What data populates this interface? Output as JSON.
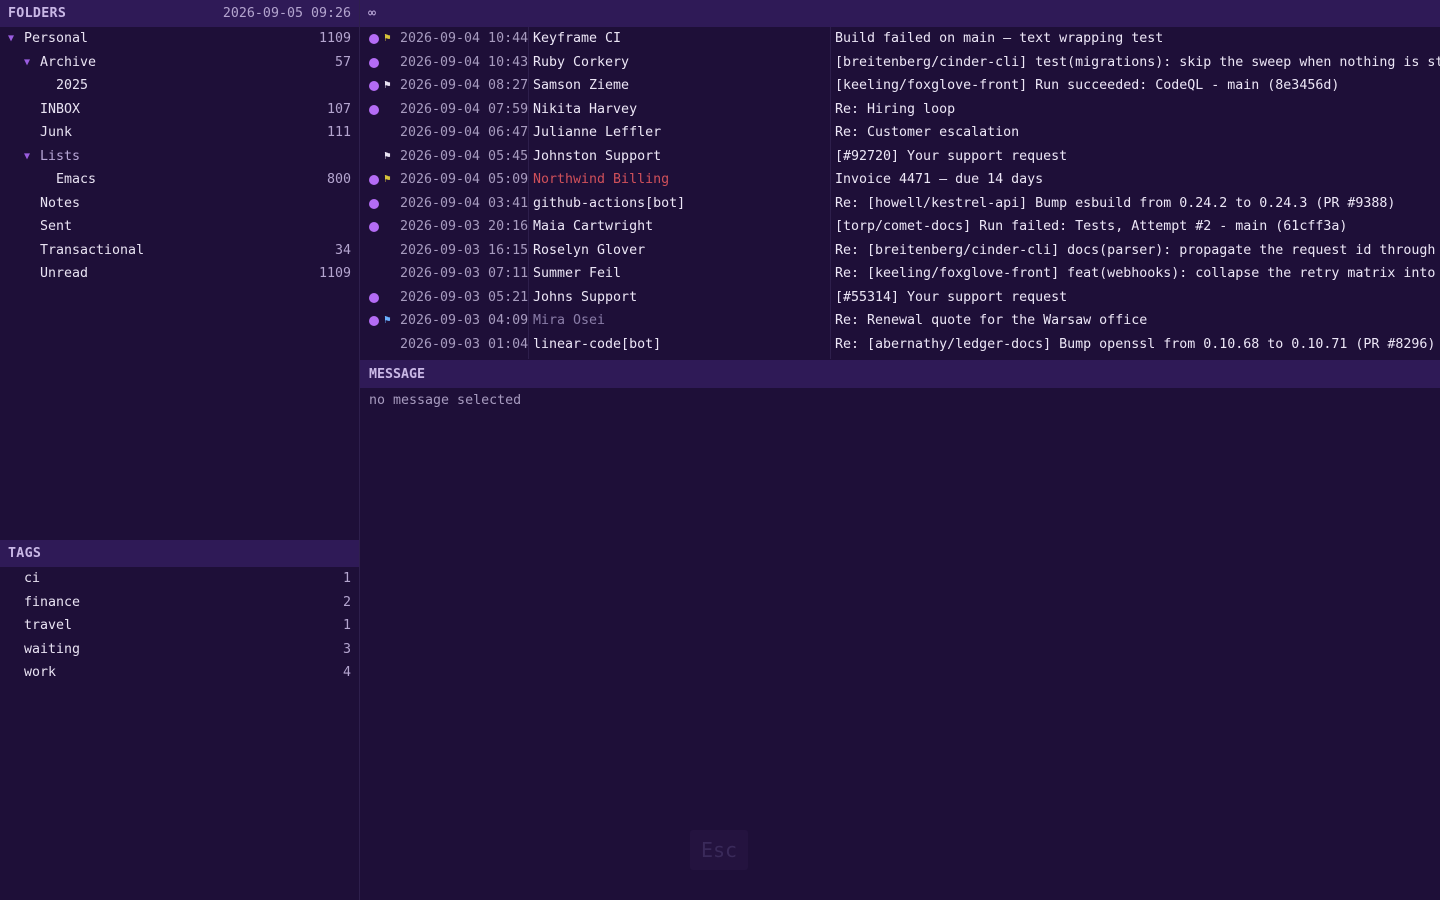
{
  "folders_panel": {
    "title": "FOLDERS",
    "datetime": "2026-09-05 09:26",
    "items": [
      {
        "name": "Personal",
        "count": "1109",
        "arrow": "▼"
      },
      {
        "name": "Archive",
        "count": "57",
        "arrow": "▼"
      },
      {
        "name": "2025",
        "count": "",
        "arrow": ""
      },
      {
        "name": "INBOX",
        "count": "107",
        "arrow": ""
      },
      {
        "name": "Junk",
        "count": "111",
        "arrow": ""
      },
      {
        "name": "Lists",
        "count": "",
        "arrow": "▼"
      },
      {
        "name": "Emacs",
        "count": "800",
        "arrow": ""
      },
      {
        "name": "Notes",
        "count": "",
        "arrow": ""
      },
      {
        "name": "Sent",
        "count": "",
        "arrow": ""
      },
      {
        "name": "Transactional",
        "count": "34",
        "arrow": ""
      },
      {
        "name": "Unread",
        "count": "1109",
        "arrow": ""
      }
    ]
  },
  "tags_panel": {
    "title": "TAGS",
    "items": [
      {
        "name": "ci",
        "count": "1"
      },
      {
        "name": "finance",
        "count": "2"
      },
      {
        "name": "travel",
        "count": "1"
      },
      {
        "name": "waiting",
        "count": "3"
      },
      {
        "name": "work",
        "count": "4"
      }
    ]
  },
  "message_list": {
    "header_glyph": "∞",
    "rows": [
      {
        "unread": true,
        "flag": "yellow",
        "date": "2026-09-04 10:44",
        "sender": "Keyframe CI",
        "sender_style": "",
        "subject": "Build failed on main — text wrapping test"
      },
      {
        "unread": true,
        "flag": "",
        "date": "2026-09-04 10:43",
        "sender": "Ruby Corkery",
        "sender_style": "",
        "subject": "[breitenberg/cinder-cli] test(migrations): skip the sweep when nothing is stal"
      },
      {
        "unread": true,
        "flag": "white",
        "date": "2026-09-04 08:27",
        "sender": "Samson Zieme",
        "sender_style": "",
        "subject": "[keeling/foxglove-front] Run succeeded: CodeQL - main (8e3456d)"
      },
      {
        "unread": true,
        "flag": "",
        "date": "2026-09-04 07:59",
        "sender": "Nikita Harvey",
        "sender_style": "",
        "subject": "Re: Hiring loop"
      },
      {
        "unread": false,
        "flag": "",
        "date": "2026-09-04 06:47",
        "sender": "Julianne Leffler",
        "sender_style": "",
        "subject": "Re: Customer escalation"
      },
      {
        "unread": false,
        "flag": "white",
        "date": "2026-09-04 05:45",
        "sender": "Johnston Support",
        "sender_style": "",
        "subject": "[#92720] Your support request"
      },
      {
        "unread": true,
        "flag": "yellow",
        "date": "2026-09-04 05:09",
        "sender": "Northwind Billing",
        "sender_style": "red",
        "subject": "Invoice 4471 — due 14 days"
      },
      {
        "unread": true,
        "flag": "",
        "date": "2026-09-04 03:41",
        "sender": "github-actions[bot]",
        "sender_style": "",
        "subject": "Re: [howell/kestrel-api] Bump esbuild from 0.24.2 to 0.24.3 (PR #9388)"
      },
      {
        "unread": true,
        "flag": "",
        "date": "2026-09-03 20:16",
        "sender": "Maia Cartwright",
        "sender_style": "",
        "subject": "[torp/comet-docs] Run failed: Tests, Attempt #2 - main (61cff3a)"
      },
      {
        "unread": false,
        "flag": "",
        "date": "2026-09-03 16:15",
        "sender": "Roselyn Glover",
        "sender_style": "",
        "subject": "Re: [breitenberg/cinder-cli] docs(parser): propagate the request id through th"
      },
      {
        "unread": false,
        "flag": "",
        "date": "2026-09-03 07:11",
        "sender": "Summer Feil",
        "sender_style": "",
        "subject": "Re: [keeling/foxglove-front] feat(webhooks): collapse the retry matrix into on"
      },
      {
        "unread": true,
        "flag": "",
        "date": "2026-09-03 05:21",
        "sender": "Johns Support",
        "sender_style": "",
        "subject": "[#55314] Your support request"
      },
      {
        "unread": true,
        "flag": "blue",
        "date": "2026-09-03 04:09",
        "sender": "Mira Osei",
        "sender_style": "muted",
        "subject": "Re: Renewal quote for the Warsaw office"
      },
      {
        "unread": false,
        "flag": "",
        "date": "2026-09-03 01:04",
        "sender": "linear-code[bot]",
        "sender_style": "",
        "subject": "Re: [abernathy/ledger-docs] Bump openssl from 0.10.68 to 0.10.71 (PR #8296)"
      }
    ]
  },
  "message_pane": {
    "title": "MESSAGE",
    "empty_text": "no message selected"
  },
  "esc_hint": "Esc",
  "colors": {
    "background": "#1e0f38",
    "header": "#2f1a57",
    "unread_dot": "#b46cf5",
    "flag_yellow": "#d6c23a",
    "flag_white": "#e8e2f2",
    "flag_blue": "#6ab0ff",
    "sender_red": "#d0505a"
  }
}
